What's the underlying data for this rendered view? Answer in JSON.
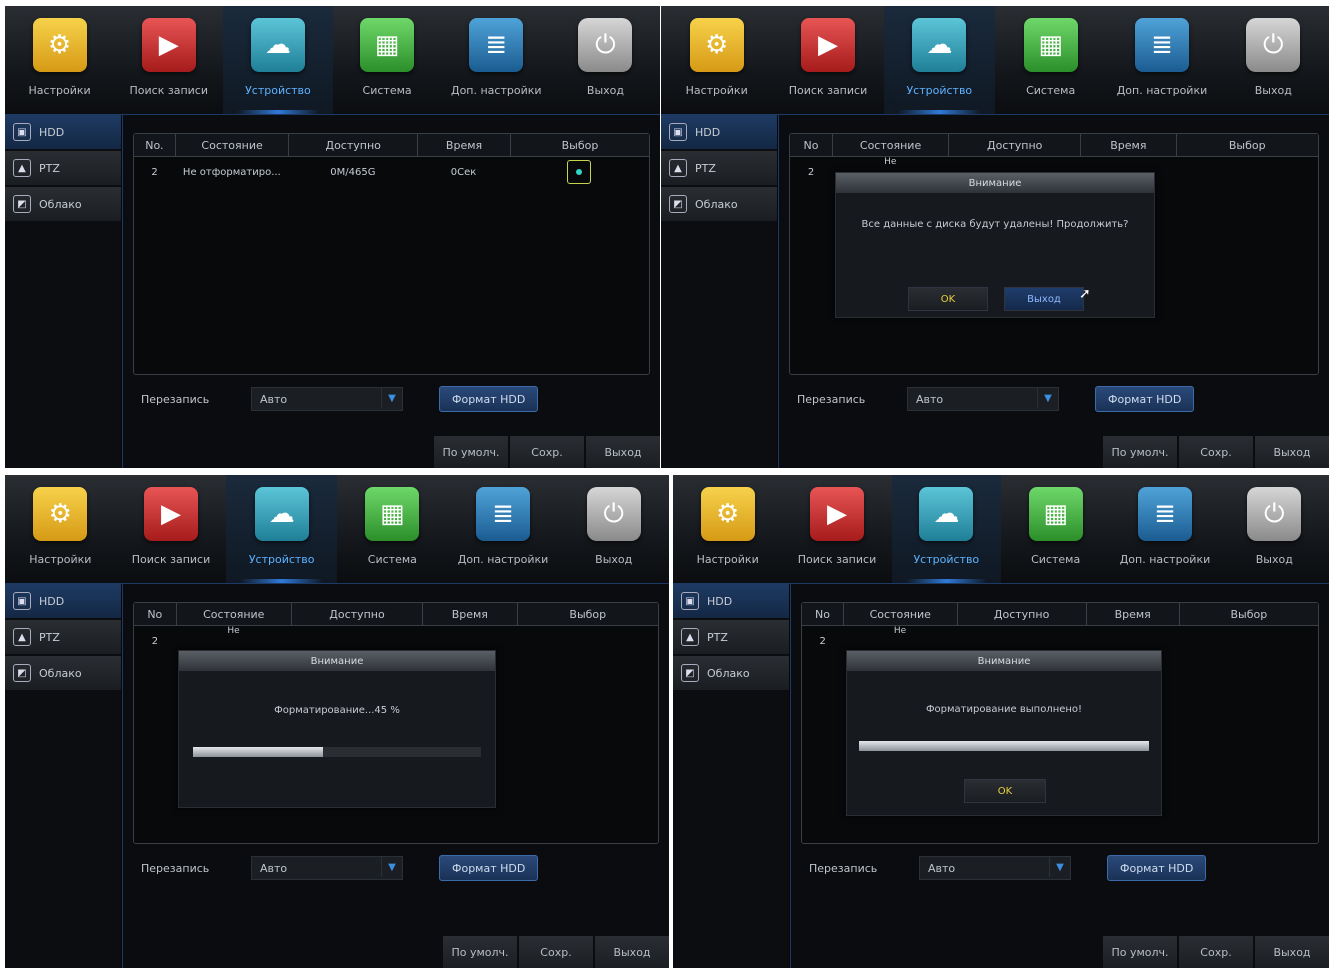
{
  "topbar": {
    "items": [
      {
        "label": "Настройки",
        "icon": "gears-icon"
      },
      {
        "label": "Поиск записи",
        "icon": "video-search-icon"
      },
      {
        "label": "Устройство",
        "icon": "cloud-storage-icon"
      },
      {
        "label": "Система",
        "icon": "calendar-info-icon"
      },
      {
        "label": "Доп. настройки",
        "icon": "list-settings-icon"
      },
      {
        "label": "Выход",
        "icon": "power-icon"
      }
    ],
    "active_index": 2
  },
  "sidebar": {
    "items": [
      {
        "label": "HDD",
        "icon": "hdd-icon"
      },
      {
        "label": "PTZ",
        "icon": "ptz-icon"
      },
      {
        "label": "Облако",
        "icon": "cloud-icon"
      }
    ]
  },
  "table": {
    "headers_p0": [
      "No.",
      "Состояние",
      "Доступно",
      "Время",
      "Выбор"
    ],
    "headers": [
      "No",
      "Состояние",
      "Доступно",
      "Время",
      "Выбор"
    ],
    "row": {
      "no": "2",
      "state": "Не отформатиро...",
      "available": "0M/465G",
      "time": "0Сек"
    },
    "hidden_state_fragment": "Не"
  },
  "overwrite": {
    "label": "Перезапись",
    "value": "Авто"
  },
  "format_button": "Формат HDD",
  "bottom_buttons": {
    "default": "По умолч.",
    "save": "Сохр.",
    "exit": "Выход"
  },
  "dialogs": {
    "title": "Внимание",
    "confirm": {
      "message": "Все данные с диска будут удалены! Продолжить?",
      "ok": "OK",
      "exit": "Выход"
    },
    "progress": {
      "message": "Форматирование...45 %",
      "progress_fraction": 0.45
    },
    "done": {
      "message": "Форматирование выполнено!",
      "progress_fraction": 1.0,
      "ok": "OK"
    }
  },
  "colors": {
    "accent": "#2f7ad8",
    "active_label": "#5db3ff",
    "ok_text": "#e8d23a",
    "select_dot": "#33d6c7"
  }
}
